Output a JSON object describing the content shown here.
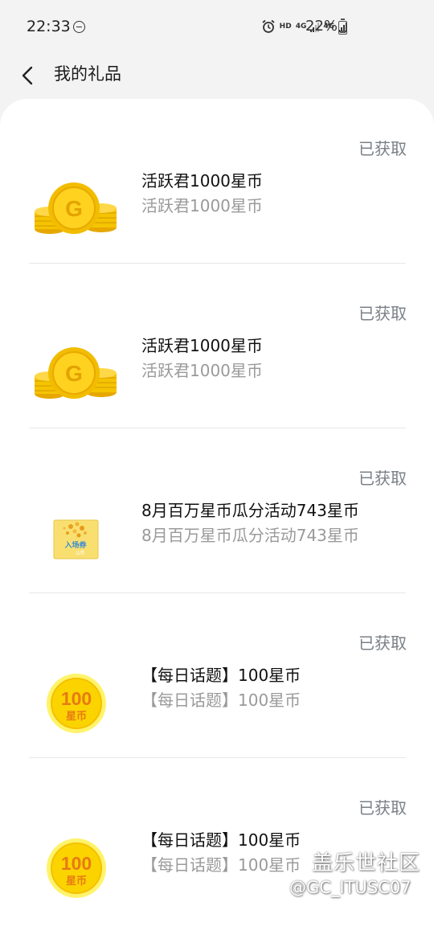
{
  "status_bar": {
    "time": "22:33",
    "network_labels": [
      "HD",
      "4G",
      "4G"
    ],
    "battery": "22%",
    "battery_level": 0.22
  },
  "header": {
    "title": "我的礼品"
  },
  "gifts": [
    {
      "name": "活跃君1000星币",
      "description": "活跃君1000星币",
      "status": "已获取",
      "icon": "gold-coins-icon"
    },
    {
      "name": "活跃君1000星币",
      "description": "活跃君1000星币",
      "status": "已获取",
      "icon": "gold-coins-icon"
    },
    {
      "name": "8月百万星币瓜分活动743星币",
      "description": "8月百万星币瓜分活动743星币",
      "status": "已获取",
      "icon": "admission-ticket-icon",
      "icon_text": [
        "入场券",
        "G币"
      ]
    },
    {
      "name": "【每日话题】100星币",
      "description": "【每日话题】100星币",
      "status": "已获取",
      "icon": "hundred-coin-icon",
      "icon_text": [
        "100",
        "星币"
      ]
    },
    {
      "name": "【每日话题】100星币",
      "description": "【每日话题】100星币",
      "status": "已获取",
      "icon": "hundred-coin-icon",
      "icon_text": [
        "100",
        "星币"
      ]
    }
  ],
  "watermark": {
    "line1": "盖乐世社区",
    "line2": "@GC_ITUSC07"
  },
  "colors": {
    "background": "#f3f3f3",
    "card": "#ffffff",
    "status_text": "#7a8087",
    "desc_text": "#9a9a9a",
    "coin_gold": "#f5c400"
  }
}
